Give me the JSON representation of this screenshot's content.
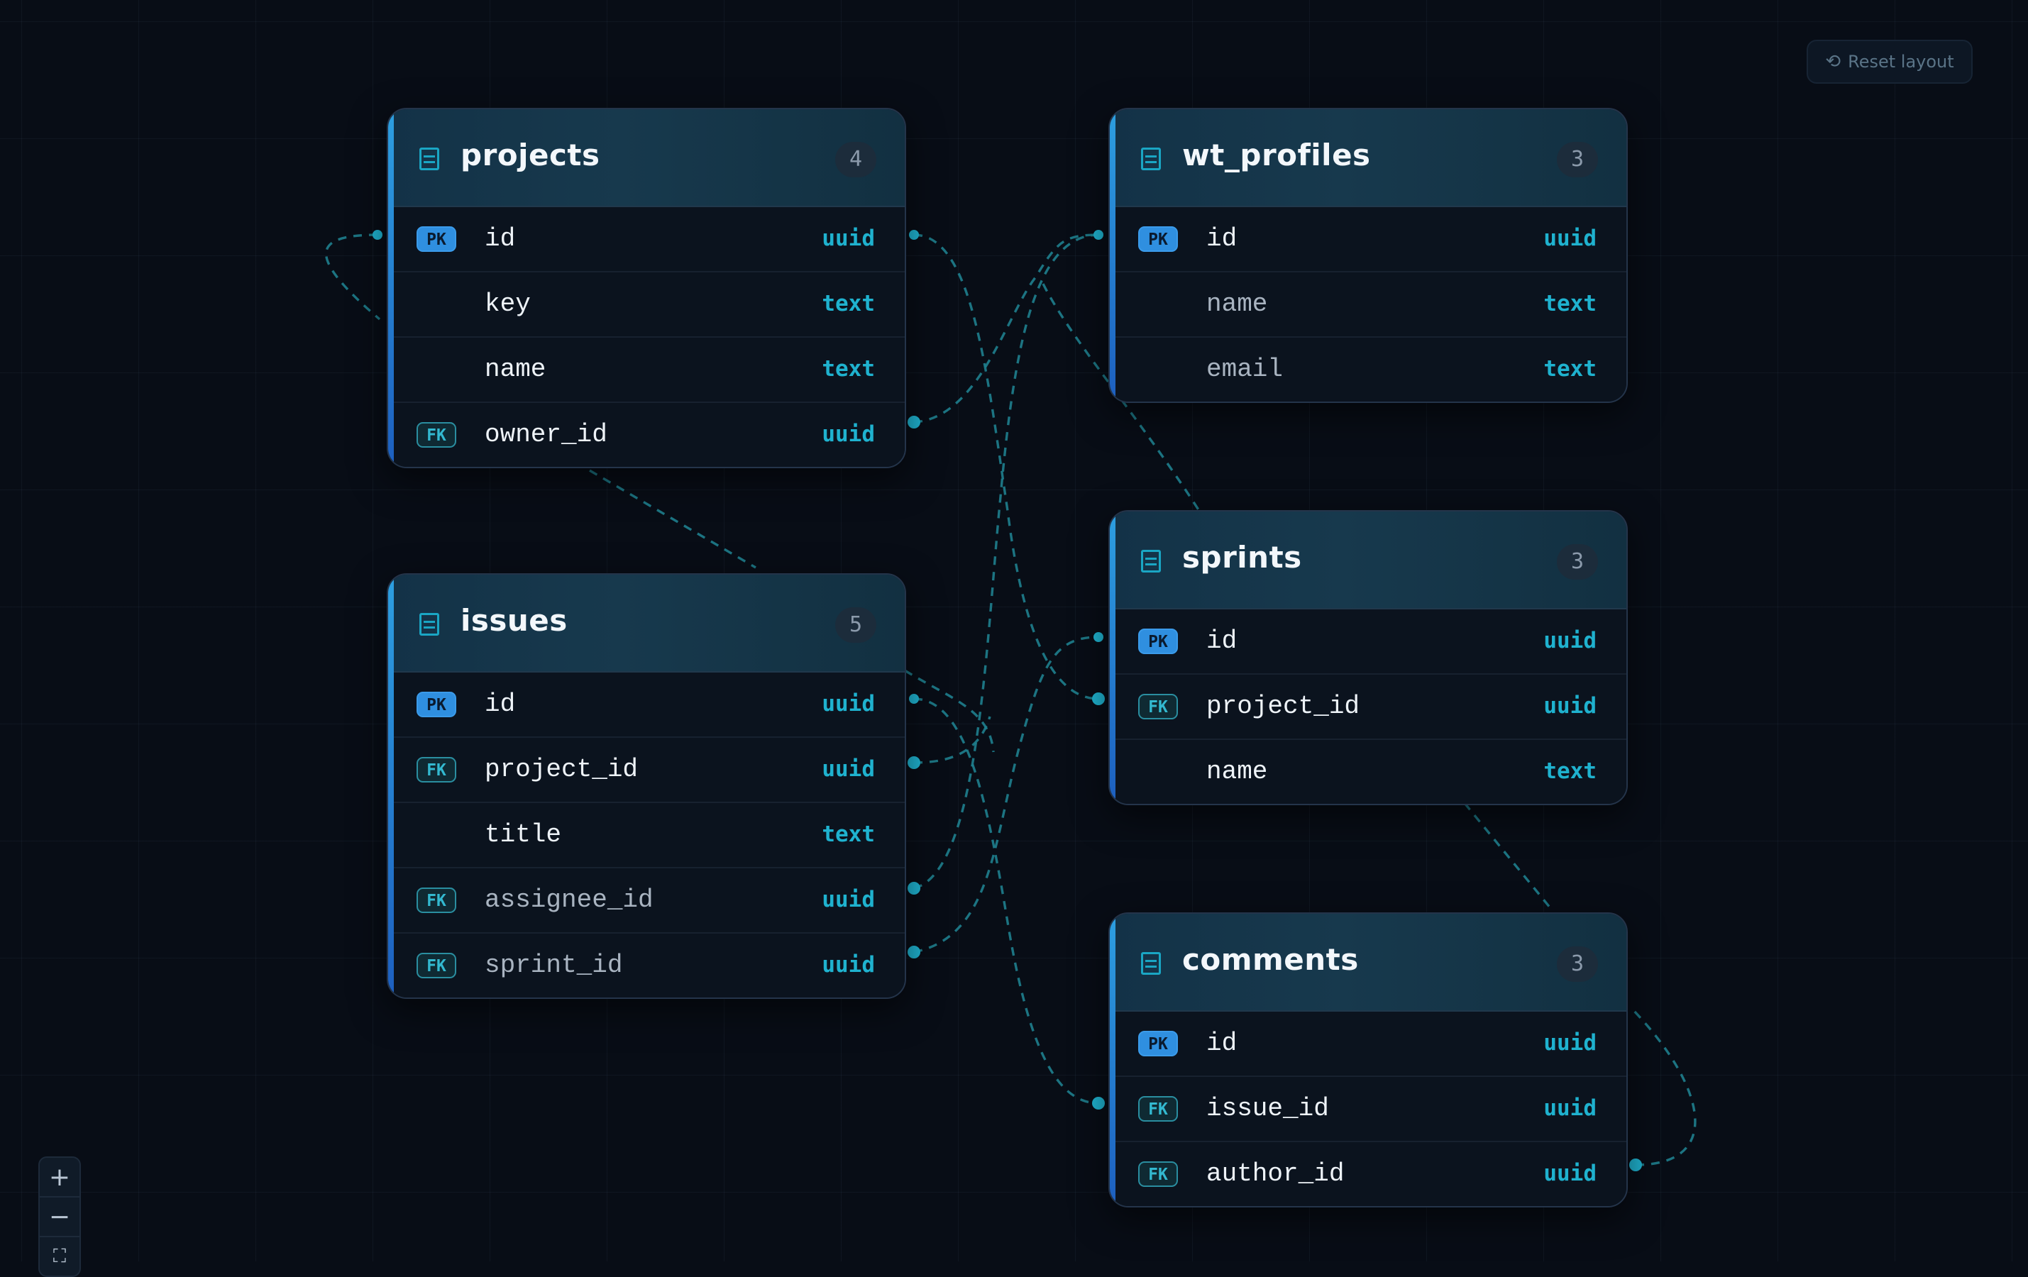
{
  "toolbar": {
    "reset_label": "Reset layout"
  },
  "zoom": {
    "in_glyph": "+",
    "out_glyph": "−",
    "fit_glyph": "⛶"
  },
  "tables": [
    {
      "name": "projects",
      "count": "4",
      "fields": [
        {
          "badge": "PK",
          "name": "id",
          "type": "uuid"
        },
        {
          "badge": "",
          "name": "key",
          "type": "text"
        },
        {
          "badge": "",
          "name": "name",
          "type": "text"
        },
        {
          "badge": "FK",
          "name": "owner_id",
          "type": "uuid"
        }
      ]
    },
    {
      "name": "wt_profiles",
      "count": "3",
      "fields": [
        {
          "badge": "PK",
          "name": "id",
          "type": "uuid"
        },
        {
          "badge": "",
          "name": "name",
          "type": "text"
        },
        {
          "badge": "",
          "name": "email",
          "type": "text"
        }
      ]
    },
    {
      "name": "issues",
      "count": "5",
      "fields": [
        {
          "badge": "PK",
          "name": "id",
          "type": "uuid"
        },
        {
          "badge": "FK",
          "name": "project_id",
          "type": "uuid"
        },
        {
          "badge": "",
          "name": "title",
          "type": "text"
        },
        {
          "badge": "FK",
          "name": "assignee_id",
          "type": "uuid"
        },
        {
          "badge": "FK",
          "name": "sprint_id",
          "type": "uuid"
        }
      ]
    },
    {
      "name": "sprints",
      "count": "3",
      "fields": [
        {
          "badge": "PK",
          "name": "id",
          "type": "uuid"
        },
        {
          "badge": "FK",
          "name": "project_id",
          "type": "uuid"
        },
        {
          "badge": "",
          "name": "name",
          "type": "text"
        }
      ]
    },
    {
      "name": "comments",
      "count": "3",
      "fields": [
        {
          "badge": "PK",
          "name": "id",
          "type": "uuid"
        },
        {
          "badge": "FK",
          "name": "issue_id",
          "type": "uuid"
        },
        {
          "badge": "FK",
          "name": "author_id",
          "type": "uuid"
        }
      ]
    }
  ],
  "colors": {
    "accent": "#1fb2cf",
    "pk": "#2f8fe0",
    "edge": "#1f7f8e",
    "background": "#080d16"
  },
  "icons": {
    "table": "table-icon",
    "reset": "reset-icon"
  }
}
